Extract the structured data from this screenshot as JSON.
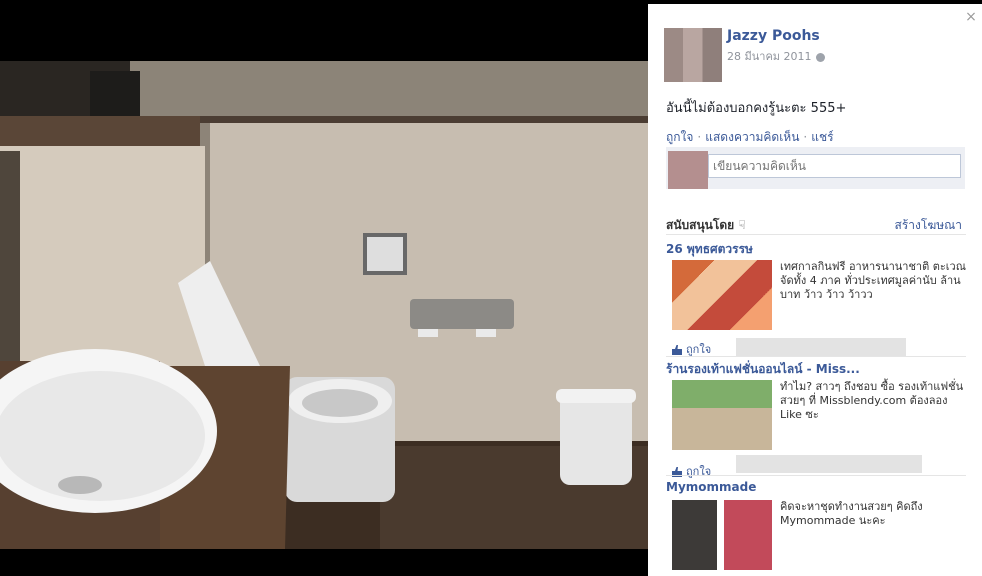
{
  "panel": {
    "close_label": "×",
    "author": "Jazzy Poohs",
    "date": "28 มีนาคม 2011",
    "caption": "อันนี้ไม่ต้องบอกคงรู้นะตะ 555+",
    "actions": [
      "ถูกใจ",
      "แสดงความคิดเห็น",
      "แชร์"
    ],
    "comment_placeholder": "เขียนความคิดเห็น",
    "sponsored_label": "สนับสนุนโดย",
    "create_ad_label": "สร้างโฆษณา",
    "like_label": "ถูกใจ"
  },
  "ads": [
    {
      "title": "26 พุทธศตวรรษ",
      "text": "เทศกาลกินฟรี อาหารนานาชาติ ตะเวณจัดทั้ง 4 ภาค ทั่วประเทศมูลค่านับ ล้านบาท ว้าว ว้าว ว้าวว"
    },
    {
      "title": "ร้านรองเท้าแฟชั่นออนไลน์ - Miss...",
      "text": "ทำไม? สาวๆ ถึงชอบ ซื้อ รองเท้าแฟชั่นสวยๆ ที่ Missblendy.com ต้องลอง Like ซะ"
    },
    {
      "title": "Mymommade",
      "text": "คิดจะหาชุดทำงานสวยๆ คิดถึง Mymommade นะคะ"
    }
  ],
  "colors": {
    "link": "#3b5998",
    "panel_bg": "#ffffff",
    "stage_bg": "#000000"
  }
}
